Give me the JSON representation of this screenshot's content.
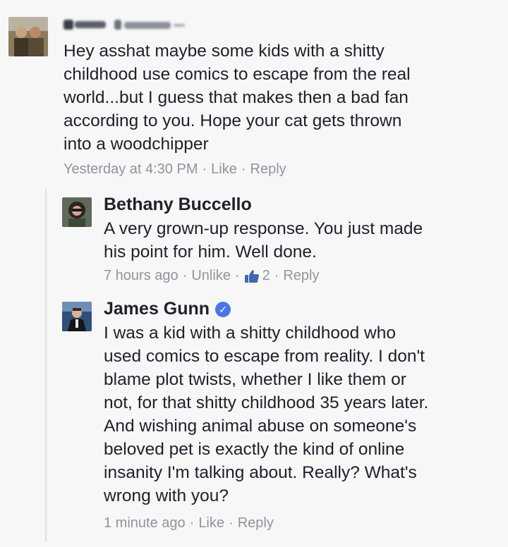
{
  "comments": [
    {
      "author": "",
      "text": "Hey asshat maybe some kids with  a shitty\nchildhood use comics to escape from the real\nworld...but I guess that makes then a bad fan\naccording to you. Hope your cat gets thrown\ninto a woodchipper",
      "time": "Yesterday at 4:30 PM",
      "action": "Like",
      "reply": "Reply"
    },
    {
      "author": "Bethany Buccello",
      "text": "A very grown-up response. You just made\nhis point for him. Well done.",
      "time": "7 hours ago",
      "action": "Unlike",
      "like_count": "2",
      "reply": "Reply"
    },
    {
      "author": "James Gunn",
      "text": "I was a kid with a shitty childhood who\nused comics to escape from reality. I don't\nblame plot twists, whether I like them or\nnot, for that shitty childhood 35 years later.\nAnd wishing animal abuse on someone's\nbeloved pet is exactly the kind of online\ninsanity I'm talking about. Really? What's\nwrong with you?",
      "time": "1 minute ago",
      "action": "Like",
      "reply": "Reply"
    }
  ],
  "separator": "·",
  "colors": {
    "meta_gray": "#90949c",
    "text": "#1d2129",
    "verified_blue": "#4a76e8",
    "like_blue": "#4267b2"
  }
}
